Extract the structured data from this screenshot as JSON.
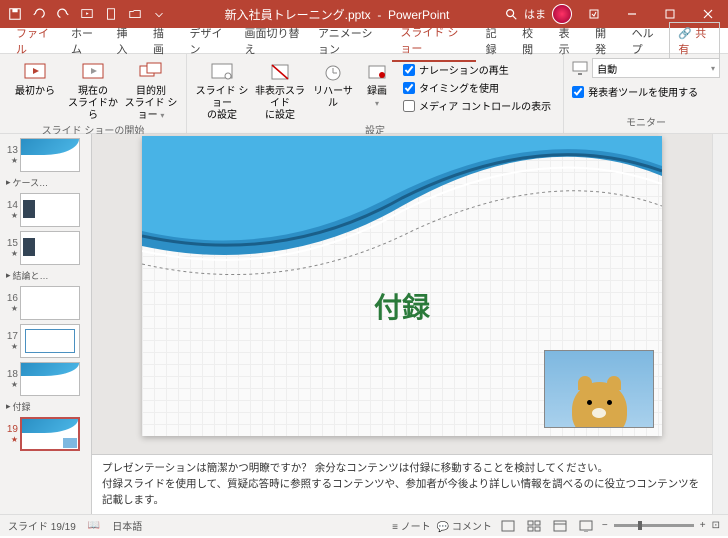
{
  "title": {
    "filename": "新入社員トレーニング.pptx",
    "app": "PowerPoint",
    "user": "はま"
  },
  "tabs": {
    "file": "ファイル",
    "home": "ホーム",
    "insert": "挿入",
    "draw": "描画",
    "design": "デザイン",
    "transitions": "画面切り替え",
    "animations": "アニメーション",
    "slideshow": "スライド ショー",
    "record": "記録",
    "review": "校閲",
    "view": "表示",
    "developer": "開発",
    "help": "ヘルプ",
    "share": "共有"
  },
  "ribbon": {
    "from_beginning": "最初から",
    "from_current": "現在の\nスライドから",
    "custom": "目的別\nスライド ショー",
    "setup": "スライド ショー\nの設定",
    "hide": "非表示スライド\nに設定",
    "rehearse": "リハーサル",
    "record": "録画",
    "narration": "ナレーションの再生",
    "timings": "タイミングを使用",
    "media_controls": "メディア コントロールの表示",
    "monitor_label": "自動",
    "presenter": "発表者ツールを使用する",
    "group_start": "スライド ショーの開始",
    "group_setup": "設定",
    "group_monitor": "モニター"
  },
  "thumbs": {
    "sec_case": "ケース…",
    "sec_conclusion": "結論と…",
    "sec_appendix": "付録",
    "n13": "13",
    "n14": "14",
    "n15": "15",
    "n16": "16",
    "n17": "17",
    "n18": "18",
    "n19": "19"
  },
  "slide": {
    "title": "付録"
  },
  "notes": {
    "line1": "プレゼンテーションは簡潔かつ明瞭ですか？ 余分なコンテンツは付録に移動することを検討してください。",
    "line2": "付録スライドを使用して、質疑応答時に参照するコンテンツや、参加者が今後より詳しい情報を調べるのに役立つコンテンツを記載します。"
  },
  "status": {
    "slide_count": "スライド 19/19",
    "lang": "日本語",
    "notes_btn": "ノート",
    "comments_btn": "コメント",
    "zoom_fit": "⊡"
  }
}
